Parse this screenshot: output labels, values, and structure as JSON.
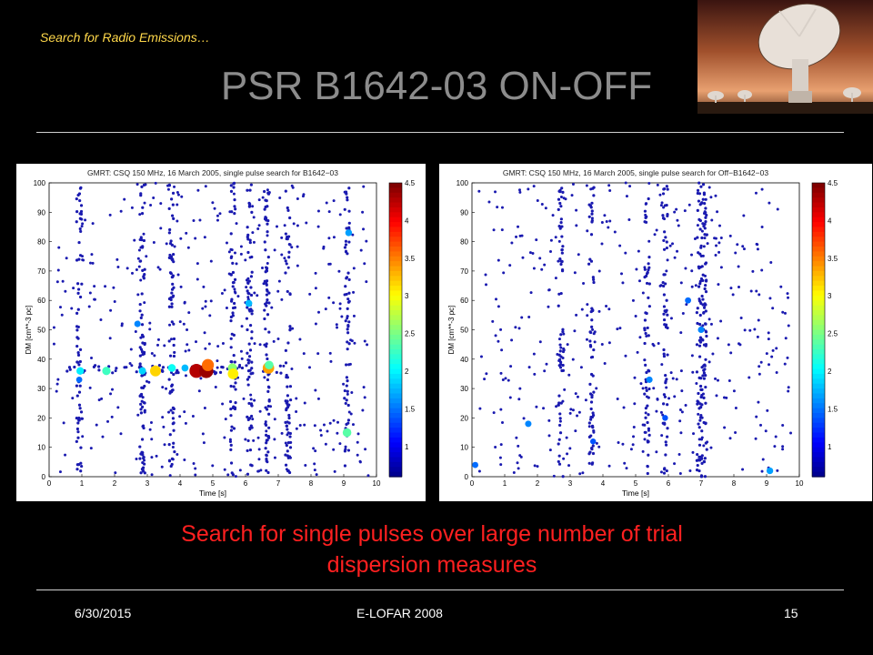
{
  "header": {
    "series_title": "Search for Radio Emissions…"
  },
  "title": "PSR B1642-03 ON-OFF",
  "caption": {
    "line1": "Search for single pulses over large number of trial",
    "line2": "dispersion measures"
  },
  "footer": {
    "date": "6/30/2015",
    "event": "E-LOFAR 2008",
    "page": "15"
  },
  "colors": {
    "background": "#000000",
    "title": "#8c8c8c",
    "header": "#ffd84a",
    "caption": "#ff2020",
    "points": "#1a1ab0"
  },
  "chart_data": [
    {
      "type": "scatter",
      "title": "GMRT: CSQ 150 MHz, 16 March 2005, single pulse search for B1642−03",
      "xlabel": "Time [s]",
      "ylabel": "DM [cm**-3 pc]",
      "xlim": [
        0,
        10
      ],
      "ylim": [
        0,
        100
      ],
      "xticks": [
        "0",
        "1",
        "2",
        "3",
        "4",
        "5",
        "6",
        "7",
        "8",
        "9",
        "10"
      ],
      "yticks": [
        "0",
        "10",
        "20",
        "30",
        "40",
        "50",
        "60",
        "70",
        "80",
        "90",
        "100"
      ],
      "colorbar": {
        "range": [
          0.6,
          4.5
        ],
        "ticks": [
          "1",
          "1.5",
          "2",
          "2.5",
          "3",
          "3.5",
          "4",
          "4.5"
        ]
      },
      "vertical_streaks": [
        0.92,
        2.85,
        3.75,
        5.62,
        6.12,
        6.65,
        7.3,
        9.1
      ],
      "highlight_points": [
        {
          "x": 0.95,
          "y": 36,
          "snr": 2.0
        },
        {
          "x": 1.75,
          "y": 36,
          "snr": 2.3
        },
        {
          "x": 2.85,
          "y": 36,
          "snr": 1.9
        },
        {
          "x": 3.25,
          "y": 36,
          "snr": 3.2
        },
        {
          "x": 3.75,
          "y": 37,
          "snr": 2.1
        },
        {
          "x": 4.15,
          "y": 37,
          "snr": 1.8
        },
        {
          "x": 4.5,
          "y": 36,
          "snr": 4.3
        },
        {
          "x": 4.8,
          "y": 36,
          "snr": 4.4
        },
        {
          "x": 4.85,
          "y": 38,
          "snr": 3.6
        },
        {
          "x": 5.6,
          "y": 37,
          "snr": 2.6
        },
        {
          "x": 5.62,
          "y": 35,
          "snr": 3.1
        },
        {
          "x": 6.7,
          "y": 37,
          "snr": 3.4
        },
        {
          "x": 6.72,
          "y": 38,
          "snr": 2.4
        },
        {
          "x": 9.15,
          "y": 83,
          "snr": 1.7
        },
        {
          "x": 9.1,
          "y": 15,
          "snr": 2.4
        },
        {
          "x": 6.1,
          "y": 59,
          "snr": 1.8
        },
        {
          "x": 2.7,
          "y": 52,
          "snr": 1.6
        },
        {
          "x": 0.92,
          "y": 33,
          "snr": 1.5
        }
      ]
    },
    {
      "type": "scatter",
      "title": "GMRT: CSQ 150 MHz, 16 March 2005, single pulse search for Off−B1642−03",
      "xlabel": "Time [s]",
      "ylabel": "DM [cm**-3 pc]",
      "xlim": [
        0,
        10
      ],
      "ylim": [
        0,
        100
      ],
      "xticks": [
        "0",
        "1",
        "2",
        "3",
        "4",
        "5",
        "6",
        "7",
        "8",
        "9",
        "10"
      ],
      "yticks": [
        "0",
        "10",
        "20",
        "30",
        "40",
        "50",
        "60",
        "70",
        "80",
        "90",
        "100"
      ],
      "colorbar": {
        "range": [
          0.6,
          4.5
        ],
        "ticks": [
          "1",
          "1.5",
          "2",
          "2.5",
          "3",
          "3.5",
          "4",
          "4.5"
        ]
      },
      "vertical_streaks": [
        2.72,
        3.65,
        5.35,
        5.9,
        6.95,
        7.1
      ],
      "highlight_points": [
        {
          "x": 0.1,
          "y": 4,
          "snr": 1.5
        },
        {
          "x": 1.72,
          "y": 18,
          "snr": 1.6
        },
        {
          "x": 3.7,
          "y": 12,
          "snr": 1.4
        },
        {
          "x": 5.42,
          "y": 33,
          "snr": 1.6
        },
        {
          "x": 5.9,
          "y": 20,
          "snr": 1.4
        },
        {
          "x": 6.6,
          "y": 60,
          "snr": 1.5
        },
        {
          "x": 7.0,
          "y": 50,
          "snr": 1.6
        },
        {
          "x": 9.1,
          "y": 2,
          "snr": 1.7
        }
      ]
    }
  ]
}
